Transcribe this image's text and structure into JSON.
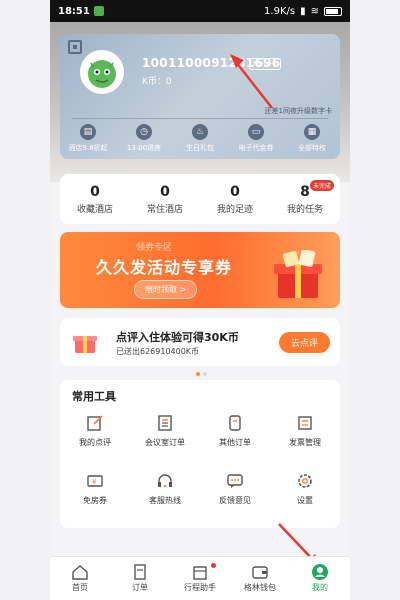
{
  "status_bar": {
    "time": "18:51",
    "network": "1.9K/s",
    "signal": "4G",
    "wifi": "wifi"
  },
  "card": {
    "user_id": "1001100091281696",
    "meta_badge": "Meta卡",
    "k_coin": "K币：0",
    "hint": "还差1间夜升级数字卡",
    "benefits": [
      {
        "label": "酒店9.8折起",
        "icon": "hotel-icon"
      },
      {
        "label": "13:00退房",
        "icon": "clock-icon"
      },
      {
        "label": "生日礼包",
        "icon": "cake-icon"
      },
      {
        "label": "电子代金券",
        "icon": "ticket-icon"
      },
      {
        "label": "全部特权",
        "icon": "grid-icon"
      }
    ]
  },
  "stats": [
    {
      "num": "0",
      "label": "收藏酒店"
    },
    {
      "num": "0",
      "label": "常住酒店"
    },
    {
      "num": "0",
      "label": "我的足迹"
    },
    {
      "num": "8",
      "label": "我的任务",
      "tag": "未完成"
    }
  ],
  "banner": {
    "top_text": "领券专区",
    "title": "久久发活动专享券",
    "button": "限时领取 >"
  },
  "promo": {
    "title": "点评入住体验可得30K币",
    "subtitle": "已送出626910400K币",
    "button": "去点评"
  },
  "tools": {
    "heading": "常用工具",
    "items": [
      {
        "label": "我的点评",
        "icon": "edit-icon"
      },
      {
        "label": "会议室订单",
        "icon": "document-icon"
      },
      {
        "label": "其他订单",
        "icon": "receipt-icon"
      },
      {
        "label": "发票管理",
        "icon": "invoice-icon"
      },
      {
        "label": "免房券",
        "icon": "coupon-icon"
      },
      {
        "label": "客服热线",
        "icon": "headset-icon"
      },
      {
        "label": "反馈意见",
        "icon": "chat-icon"
      },
      {
        "label": "设置",
        "icon": "gear-icon"
      }
    ]
  },
  "bottom_nav": [
    {
      "label": "首页",
      "icon": "home-icon"
    },
    {
      "label": "订单",
      "icon": "order-icon"
    },
    {
      "label": "行程助手",
      "icon": "calendar-icon"
    },
    {
      "label": "格林钱包",
      "icon": "wallet-icon"
    },
    {
      "label": "我的",
      "icon": "user-icon",
      "active": true
    }
  ],
  "colors": {
    "accent_green": "#21a661",
    "accent_orange": "#ff7a2e",
    "red": "#e9392e"
  }
}
